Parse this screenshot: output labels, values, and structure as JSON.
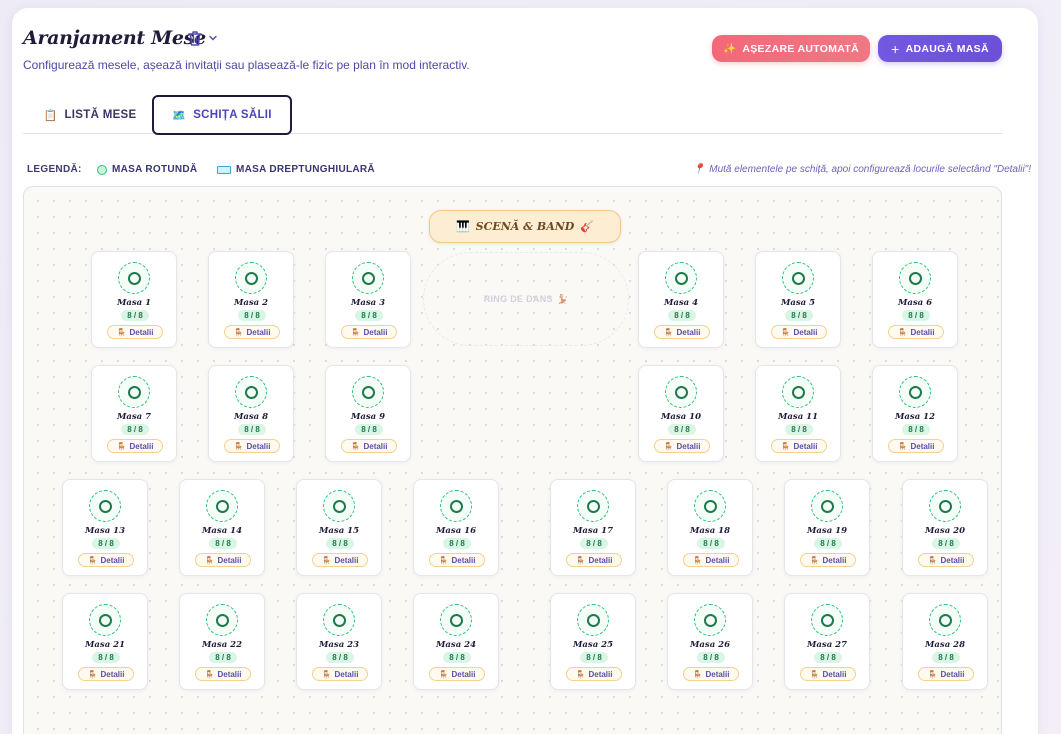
{
  "header": {
    "title": "Aranjament Mese",
    "subtitle": "Configurează mesele, așează invitații sau plasează-le fizic pe plan în mod interactiv."
  },
  "actions": {
    "auto_label": "AȘEZARE AUTOMATĂ",
    "add_label": "ADAUGĂ MASĂ"
  },
  "tabs": [
    {
      "label": "LISTĂ MESE",
      "icon": "clipboard-icon",
      "active": false
    },
    {
      "label": "SCHIȚA SĂLII",
      "icon": "map-icon",
      "active": true
    }
  ],
  "legend": {
    "label": "LEGENDĂ:",
    "round": "MASA ROTUNDĂ",
    "rect": "MASA DREPTUNGHIULARĂ",
    "hint": "Mută elementele pe schiță, apoi configurează locurile selectând \"Detalii\"!"
  },
  "venue": {
    "stage_label": "SCENĂ & BAND",
    "dance_label": "RING DE DANS"
  },
  "colors": {
    "accent_coral": "#f4677a",
    "accent_purple": "#7358e0",
    "table_green": "#2fc07a",
    "stage_bg": "#fcedd3"
  },
  "tables": [
    {
      "name": "Masa 1",
      "count": "8 / 8",
      "action": "Detalii"
    },
    {
      "name": "Masa 2",
      "count": "8 / 8",
      "action": "Detalii"
    },
    {
      "name": "Masa 3",
      "count": "8 / 8",
      "action": "Detalii"
    },
    {
      "name": "Masa 4",
      "count": "8 / 8",
      "action": "Detalii"
    },
    {
      "name": "Masa 5",
      "count": "8 / 8",
      "action": "Detalii"
    },
    {
      "name": "Masa 6",
      "count": "8 / 8",
      "action": "Detalii"
    },
    {
      "name": "Masa 7",
      "count": "8 / 8",
      "action": "Detalii"
    },
    {
      "name": "Masa 8",
      "count": "8 / 8",
      "action": "Detalii"
    },
    {
      "name": "Masa 9",
      "count": "8 / 8",
      "action": "Detalii"
    },
    {
      "name": "Masa 10",
      "count": "8 / 8",
      "action": "Detalii"
    },
    {
      "name": "Masa 11",
      "count": "8 / 8",
      "action": "Detalii"
    },
    {
      "name": "Masa 12",
      "count": "8 / 8",
      "action": "Detalii"
    },
    {
      "name": "Masa 13",
      "count": "8 / 8",
      "action": "Detalii"
    },
    {
      "name": "Masa 14",
      "count": "8 / 8",
      "action": "Detalii"
    },
    {
      "name": "Masa 15",
      "count": "8 / 8",
      "action": "Detalii"
    },
    {
      "name": "Masa 16",
      "count": "8 / 8",
      "action": "Detalii"
    },
    {
      "name": "Masa 17",
      "count": "8 / 8",
      "action": "Detalii"
    },
    {
      "name": "Masa 18",
      "count": "8 / 8",
      "action": "Detalii"
    },
    {
      "name": "Masa 19",
      "count": "8 / 8",
      "action": "Detalii"
    },
    {
      "name": "Masa 20",
      "count": "8 / 8",
      "action": "Detalii"
    },
    {
      "name": "Masa 21",
      "count": "8 / 8",
      "action": "Detalii"
    },
    {
      "name": "Masa 22",
      "count": "8 / 8",
      "action": "Detalii"
    },
    {
      "name": "Masa 23",
      "count": "8 / 8",
      "action": "Detalii"
    },
    {
      "name": "Masa 24",
      "count": "8 / 8",
      "action": "Detalii"
    },
    {
      "name": "Masa 25",
      "count": "8 / 8",
      "action": "Detalii"
    },
    {
      "name": "Masa 26",
      "count": "8 / 8",
      "action": "Detalii"
    },
    {
      "name": "Masa 27",
      "count": "8 / 8",
      "action": "Detalii"
    },
    {
      "name": "Masa 28",
      "count": "8 / 8",
      "action": "Detalii"
    }
  ]
}
